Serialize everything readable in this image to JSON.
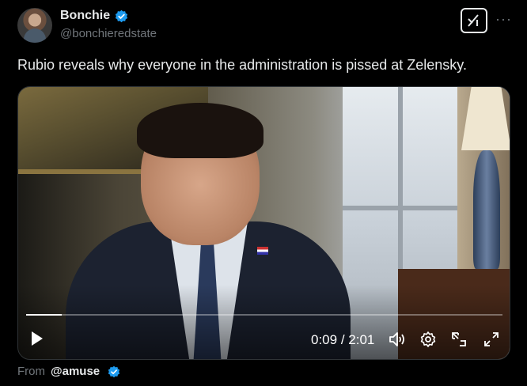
{
  "author": {
    "display_name": "Bonchie",
    "handle": "@bonchieredstate",
    "verified_color": "#1d9bf0"
  },
  "post": {
    "text": "Rubio reveals why everyone in the administration is pissed at Zelensky."
  },
  "header_actions": {
    "grok_icon": "grok-icon",
    "more_label": "···"
  },
  "video": {
    "current_time": "0:09",
    "separator": " / ",
    "duration": "2:01",
    "progress_fraction": 0.074
  },
  "attribution": {
    "prefix": "From",
    "handle": "@amuse"
  }
}
